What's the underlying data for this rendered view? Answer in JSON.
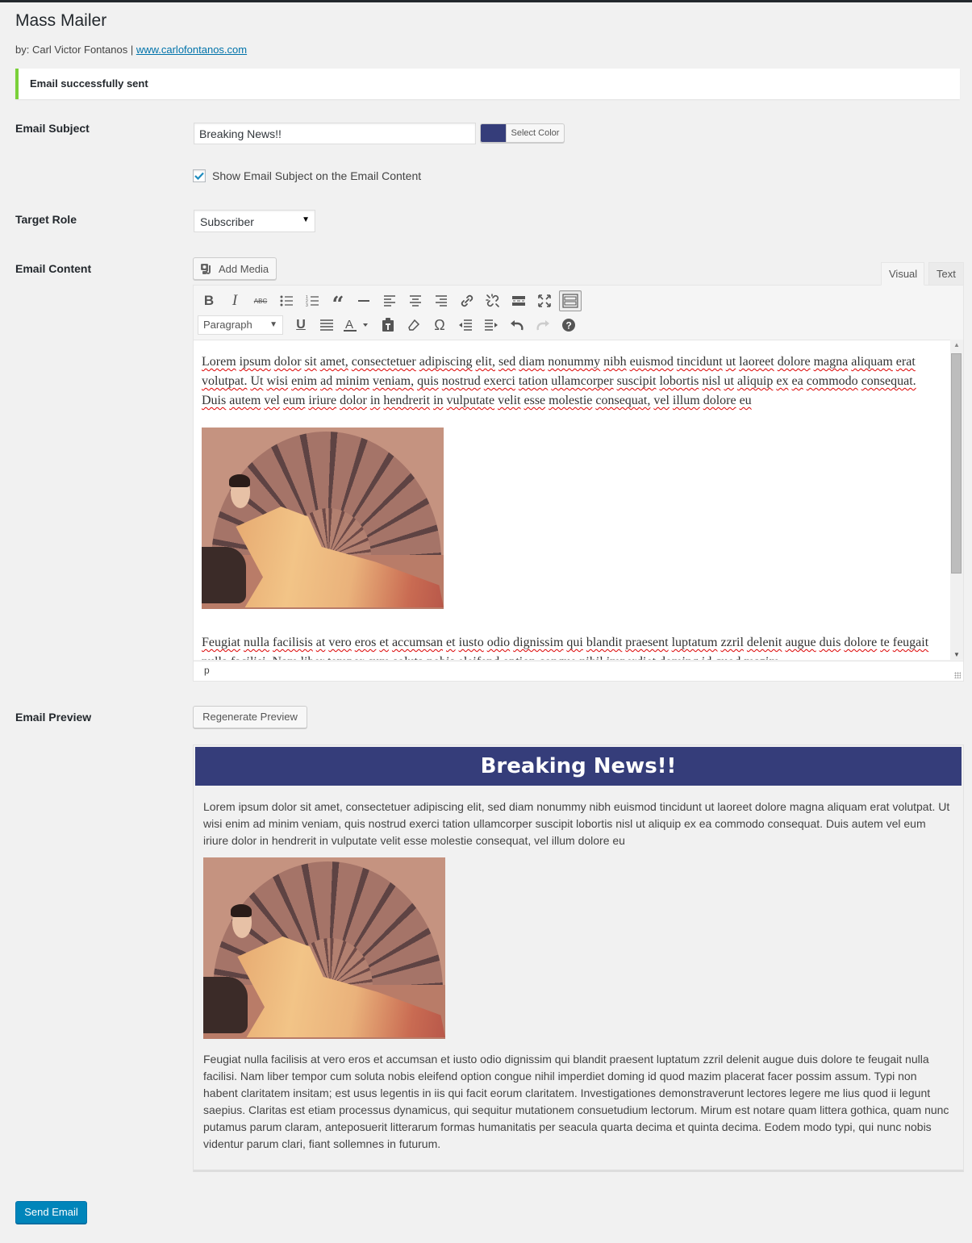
{
  "page": {
    "title": "Mass Mailer",
    "byline_prefix": "by: Carl Victor Fontanos | ",
    "byline_link": "www.carlofontanos.com"
  },
  "notice": {
    "message": "Email successfully sent",
    "color": "#7ad03a"
  },
  "form": {
    "subject_label": "Email Subject",
    "subject_value": "Breaking News!!",
    "select_color_label": "Select Color",
    "selected_color": "#353d7a",
    "show_subject_checkbox": {
      "label": "Show Email Subject on the Email Content",
      "checked": true
    },
    "target_role_label": "Target Role",
    "target_role_value": "Subscriber",
    "content_label": "Email Content",
    "preview_label": "Email Preview"
  },
  "editor": {
    "add_media_label": "Add Media",
    "tabs": [
      {
        "label": "Visual",
        "active": true
      },
      {
        "label": "Text",
        "active": false
      }
    ],
    "toolbar_row1": [
      "bold-icon",
      "italic-icon",
      "strikethrough-icon",
      "bullet-list-icon",
      "numbered-list-icon",
      "blockquote-icon",
      "horizontal-rule-icon",
      "align-left-icon",
      "align-center-icon",
      "align-right-icon",
      "link-icon",
      "unlink-icon",
      "read-more-icon",
      "fullscreen-icon",
      "toolbar-toggle-icon"
    ],
    "format_select_value": "Paragraph",
    "toolbar_row2": [
      "underline-icon",
      "justify-icon",
      "text-color-icon",
      "paste-as-text-icon",
      "clear-formatting-icon",
      "special-character-icon",
      "outdent-icon",
      "indent-icon",
      "undo-icon",
      "redo-icon",
      "help-icon"
    ],
    "paragraph1": "Lorem ipsum dolor sit amet, consectetuer adipiscing elit, sed diam nonummy nibh euismod tincidunt ut laoreet dolore magna aliquam erat volutpat. Ut wisi enim ad minim veniam, quis nostrud exerci tation ullamcorper suscipit lobortis nisl ut aliquip ex ea commodo consequat. Duis autem vel eum iriure dolor in hendrerit in vulputate velit esse molestie consequat, vel illum dolore eu",
    "paragraph2": "Feugiat nulla facilisis at vero eros et accumsan et iusto odio dignissim qui blandit praesent luptatum zzril delenit augue duis dolore te feugait nulla facilisi. Nam liber tempor cum soluta nobis eleifend option congue nihil imperdiet doming id quod mazim",
    "image_alt": "Painting of a woman reclining before a rose window",
    "status_path": "p"
  },
  "preview": {
    "regenerate_label": "Regenerate Preview",
    "header_text": "Breaking News!!",
    "paragraph1": "Lorem ipsum dolor sit amet, consectetuer adipiscing elit, sed diam nonummy nibh euismod tincidunt ut laoreet dolore magna aliquam erat volutpat. Ut wisi enim ad minim veniam, quis nostrud exerci tation ullamcorper suscipit lobortis nisl ut aliquip ex ea commodo consequat. Duis autem vel eum iriure dolor in hendrerit in vulputate velit esse molestie consequat, vel illum dolore eu",
    "paragraph2": "Feugiat nulla facilisis at vero eros et accumsan et iusto odio dignissim qui blandit praesent luptatum zzril delenit augue duis dolore te feugait nulla facilisi. Nam liber tempor cum soluta nobis eleifend option congue nihil imperdiet doming id quod mazim placerat facer possim assum. Typi non habent claritatem insitam; est usus legentis in iis qui facit eorum claritatem. Investigationes demonstraverunt lectores legere me lius quod ii legunt saepius. Claritas est etiam processus dynamicus, qui sequitur mutationem consuetudium lectorum. Mirum est notare quam littera gothica, quam nunc putamus parum claram, anteposuerit litterarum formas humanitatis per seacula quarta decima et quinta decima. Eodem modo typi, qui nunc nobis videntur parum clari, fiant sollemnes in futurum."
  },
  "actions": {
    "send_label": "Send Email",
    "send_color": "#0085ba"
  }
}
